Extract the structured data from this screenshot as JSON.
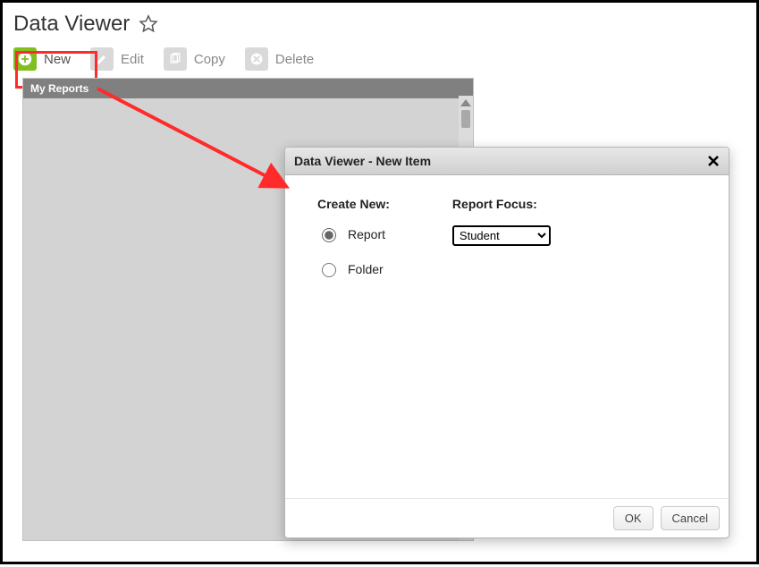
{
  "page_title": "Data Viewer",
  "toolbar": {
    "new_label": "New",
    "edit_label": "Edit",
    "copy_label": "Copy",
    "delete_label": "Delete"
  },
  "reports_panel": {
    "title": "My Reports"
  },
  "dialog": {
    "title": "Data Viewer - New Item",
    "create_new_label": "Create New:",
    "option_report": "Report",
    "option_folder": "Folder",
    "selected_option": "report",
    "report_focus_label": "Report Focus:",
    "focus_options": [
      "Student"
    ],
    "focus_selected": "Student",
    "ok_label": "OK",
    "cancel_label": "Cancel"
  },
  "colors": {
    "accent_green": "#7fbf1f",
    "annotation_red": "#ff2b2b"
  }
}
